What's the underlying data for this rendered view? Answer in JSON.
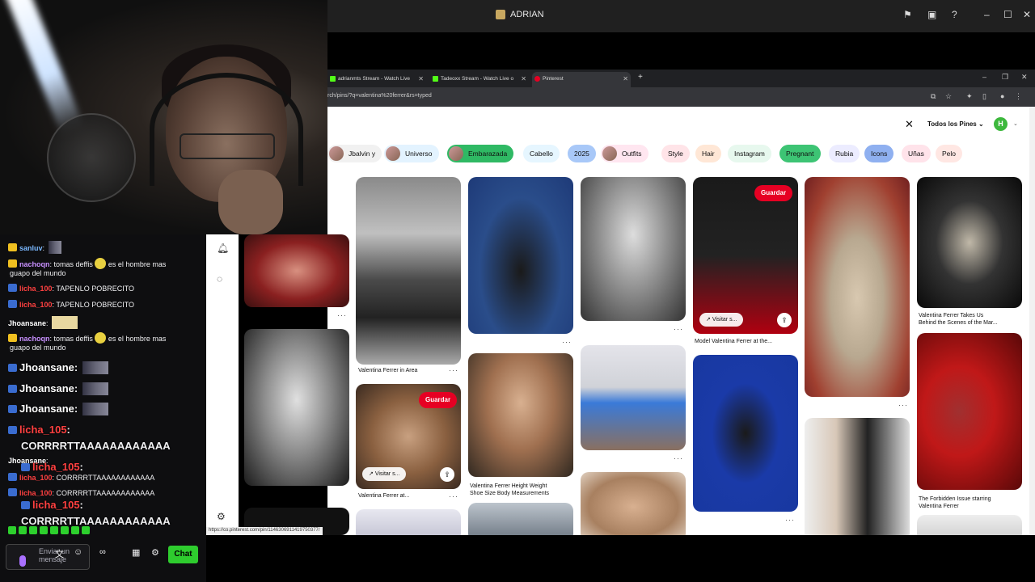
{
  "os": {
    "window_title": "ADRIAN",
    "icons": [
      "flag-icon",
      "screen-icon",
      "help-icon",
      "minimize-icon",
      "maximize-icon",
      "close-icon"
    ]
  },
  "browser": {
    "tabs": [
      {
        "label": "adrianmts Stream - Watch Live",
        "favicon_color": "#53fc18"
      },
      {
        "label": "Tadeoxx Stream - Watch Live o",
        "favicon_color": "#53fc18"
      },
      {
        "label": "Pinterest",
        "favicon_color": "#e60023"
      }
    ],
    "url": "rch/pins/?q=valentina%20ferrer&rs=typed"
  },
  "pinterest": {
    "all_pins_label": "Todos los Pines",
    "avatar_letter": "H",
    "chips": [
      {
        "label": "Jbalvin y",
        "bg": "#f1f1f1",
        "image": true
      },
      {
        "label": "Universo",
        "bg": "#e3f3ff",
        "image": true
      },
      {
        "label": "Embarazada",
        "bg": "#2fb964",
        "image": true
      },
      {
        "label": "Cabello",
        "bg": "#e6f6ff",
        "image": false
      },
      {
        "label": "2025",
        "bg": "#a8c8f8",
        "image": false
      },
      {
        "label": "Outfits",
        "bg": "#ffe6f0",
        "image": true
      },
      {
        "label": "Style",
        "bg": "#ffe4e8",
        "image": false
      },
      {
        "label": "Hair",
        "bg": "#ffe7d6",
        "image": false
      },
      {
        "label": "Instagram",
        "bg": "#e7f8ee",
        "image": false
      },
      {
        "label": "Pregnant",
        "bg": "#3dc474",
        "image": false
      },
      {
        "label": "Rubia",
        "bg": "#ececff",
        "image": false
      },
      {
        "label": "Icons",
        "bg": "#8fb0f0",
        "image": false
      },
      {
        "label": "Uñas",
        "bg": "#ffe3ea",
        "image": false
      },
      {
        "label": "Pelo",
        "bg": "#ffe7e3",
        "image": false
      }
    ],
    "pins": [
      {
        "caption": ""
      },
      {
        "caption": "Valentina Ferrer in Area"
      },
      {
        "caption": ""
      },
      {
        "caption": ""
      },
      {
        "caption": "Model Valentina Ferrer at the..."
      },
      {
        "caption": ""
      },
      {
        "caption": "Valentina Ferrer Takes Us\nBehind the Scenes of the Mar..."
      },
      {
        "caption": ""
      },
      {
        "caption": "Valentina Ferrer at..."
      },
      {
        "caption": "Valentina Ferrer Height Weight\nShoe Size Body Measurements"
      },
      {
        "caption": ""
      },
      {
        "caption": ""
      },
      {
        "caption": ""
      },
      {
        "caption": "The Forbidden Issue starring\nValentina Ferrer"
      }
    ],
    "save_label": "Guardar",
    "visit_label": "Visitar s...",
    "status_url": "https://co.pinterest.com/pin/1146306911419750377/"
  },
  "chat": {
    "messages": [
      {
        "user": "sanluv",
        "text": ":",
        "user_color": "sanluv",
        "badge": "crown",
        "big": false,
        "emote": true
      },
      {
        "user": "nachoqn",
        "text": ": tomas deffis",
        "text2": "es el hombre mas",
        "cont": "guapo del mundo",
        "user_color": "nacho",
        "badge": "crown",
        "big": false
      },
      {
        "user": "licha_100",
        "text": ": TAPENLO POBRECITO",
        "user_color": "licha",
        "badge": "vip",
        "big": false
      },
      {
        "user": "licha_100",
        "text": ": TAPENLO POBRECITO",
        "user_color": "licha",
        "badge": "vip",
        "big": false
      },
      {
        "user": "Jhoansane",
        "text": ":",
        "user_color": "jho",
        "badge": "",
        "big": false,
        "emote": true
      },
      {
        "user": "nachoqn",
        "text": ": tomas deffis",
        "text2": "es el hombre mas",
        "cont": "guapo del mundo",
        "user_color": "nacho",
        "badge": "crown",
        "big": false
      },
      {
        "user": "Jhoansane",
        "text": ":",
        "user_color": "jho",
        "badge": "vip",
        "big": true,
        "emote": true
      },
      {
        "user": "Jhoansane",
        "text": ":",
        "user_color": "jho",
        "badge": "vip",
        "big": true,
        "emote": true
      },
      {
        "user": "Jhoansane",
        "text": ":",
        "user_color": "jho",
        "badge": "vip",
        "big": true,
        "emote": true
      },
      {
        "user": "licha_105",
        "text": ":",
        "user_color": "licha",
        "badge": "vip",
        "big": true
      },
      {
        "user": "",
        "text": "CORRRRTTAAAAAAAAAAAA",
        "user_color": "jho",
        "badge": "",
        "big": true
      },
      {
        "user": "Jhoansane",
        "text": ":",
        "user_color": "jho",
        "badge": "",
        "big": false
      },
      {
        "user": "licha_105",
        "text": ":",
        "user_color": "licha",
        "badge": "vip",
        "big": true
      },
      {
        "user": "licha_100",
        "text": ": CORRRRTTAAAAAAAAAAAA",
        "user_color": "licha",
        "badge": "vip",
        "big": false
      },
      {
        "user": "licha_100",
        "text": ": CORRRRTTAAAAAAAAAAAA",
        "user_color": "licha",
        "badge": "vip",
        "big": false
      },
      {
        "user": "licha_105",
        "text": ":",
        "user_color": "licha",
        "badge": "vip",
        "big": true
      },
      {
        "user": "",
        "text": "CORRRRTTAAAAAAAAAAAA",
        "user_color": "jho",
        "badge": "",
        "big": true
      }
    ],
    "input_placeholder": "Enviar un mensaje",
    "send_label": "Chat"
  }
}
